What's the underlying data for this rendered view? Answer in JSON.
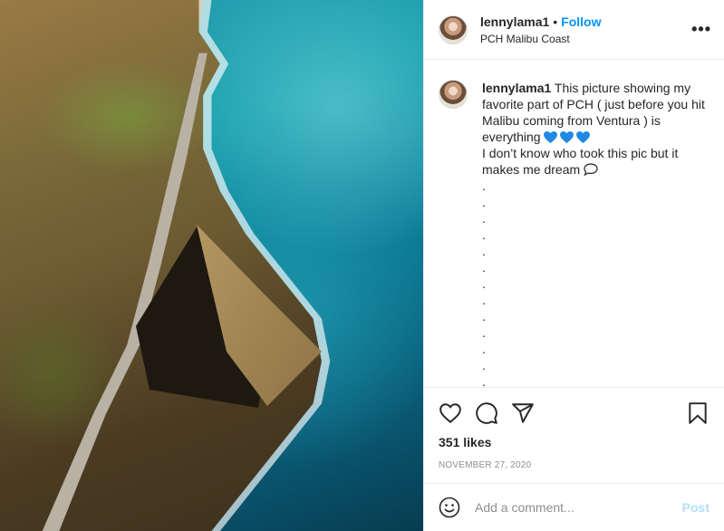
{
  "header": {
    "username": "lennylama1",
    "separator": "•",
    "follow_label": "Follow",
    "location": "PCH Malibu Coast",
    "more_icon": "more-horizontal-icon"
  },
  "caption": {
    "username": "lennylama1",
    "text_before_hearts": "This picture showing my favorite part of PCH ( just before you hit Malibu coming from Ventura ) is everything",
    "heart_emoji_color": "#1e88e5",
    "heart_count": 3,
    "text_after_hearts": "I don’t know who took this pic but it makes me dream",
    "trailing_icon": "speech-bubble-icon",
    "dots": [
      ".",
      ".",
      ".",
      ".",
      ".",
      ".",
      ".",
      ".",
      ".",
      ".",
      ".",
      ".",
      "."
    ]
  },
  "actions": {
    "like_icon": "heart-icon",
    "comment_icon": "comment-icon",
    "share_icon": "share-icon",
    "save_icon": "bookmark-icon",
    "likes_text": "351 likes",
    "date_text": "NOVEMBER 27, 2020"
  },
  "add_comment": {
    "emoji_icon": "smiley-icon",
    "placeholder": "Add a comment...",
    "post_label": "Post",
    "post_color": "#b2dffc"
  },
  "colors": {
    "accent": "#0095f6",
    "text": "#262626",
    "muted": "#8e8e8e",
    "border": "#efefef"
  }
}
